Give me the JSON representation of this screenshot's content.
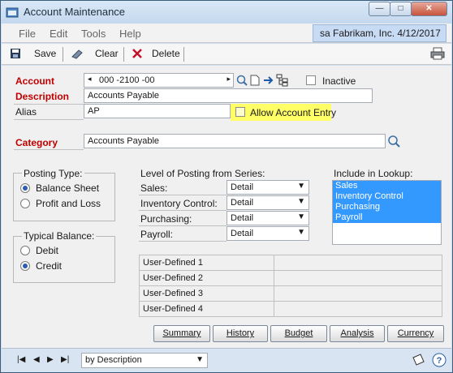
{
  "window": {
    "title": "Account Maintenance",
    "min": "—",
    "max": "□",
    "close": "✕"
  },
  "menu": {
    "items": [
      "File",
      "Edit",
      "Tools",
      "Help"
    ],
    "context": "sa  Fabrikam, Inc.  4/12/2017"
  },
  "toolbar": {
    "save": "Save",
    "clear": "Clear",
    "delete": "Delete"
  },
  "form": {
    "account_label": "Account",
    "account_value": "000 -2100 -00",
    "inactive_label": "Inactive",
    "description_label": "Description",
    "description_value": "Accounts Payable",
    "alias_label": "Alias",
    "alias_value": "AP",
    "allow_entry_label": "Allow Account Entry",
    "category_label": "Category",
    "category_value": "Accounts Payable"
  },
  "posting_type": {
    "label": "Posting Type:",
    "options": [
      "Balance Sheet",
      "Profit and Loss"
    ],
    "selected": 0
  },
  "typical_balance": {
    "label": "Typical Balance:",
    "options": [
      "Debit",
      "Credit"
    ],
    "selected": 1
  },
  "level_posting": {
    "label": "Level of Posting from Series:",
    "rows": [
      {
        "name": "Sales:",
        "value": "Detail"
      },
      {
        "name": "Inventory Control:",
        "value": "Detail"
      },
      {
        "name": "Purchasing:",
        "value": "Detail"
      },
      {
        "name": "Payroll:",
        "value": "Detail"
      }
    ]
  },
  "lookup": {
    "label": "Include in Lookup:",
    "items": [
      "Sales",
      "Inventory Control",
      "Purchasing",
      "Payroll"
    ]
  },
  "user_defined": [
    "User-Defined 1",
    "User-Defined 2",
    "User-Defined 3",
    "User-Defined 4"
  ],
  "buttons": [
    "Summary",
    "History",
    "Budget",
    "Analysis",
    "Currency"
  ],
  "footer": {
    "sort": "by Description"
  }
}
